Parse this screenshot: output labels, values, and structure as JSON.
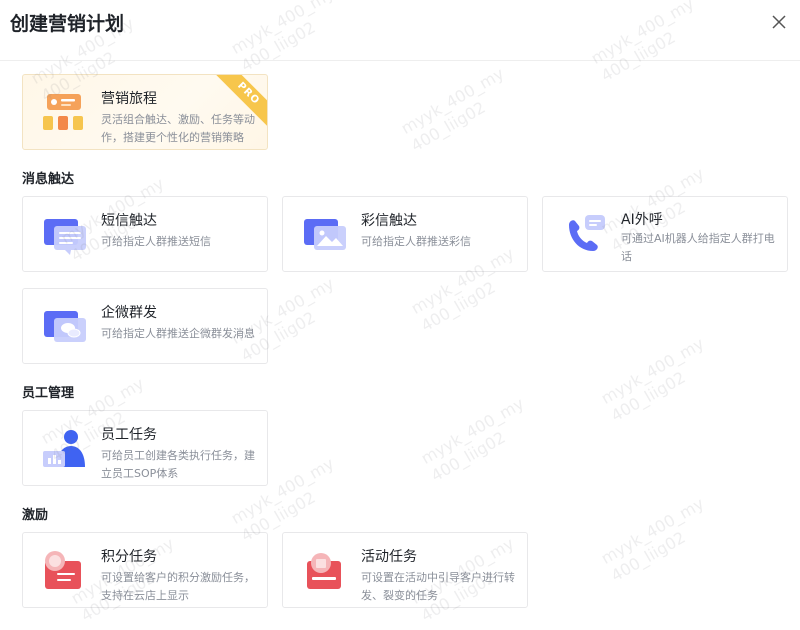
{
  "dialog": {
    "title": "创建营销计划",
    "close_icon": "close-icon"
  },
  "featured": {
    "title": "营销旅程",
    "desc": "灵活组合触达、激励、任务等动作，搭建更个性化的营销策略",
    "badge": "PRO",
    "icon": "journey-icon"
  },
  "sections": [
    {
      "title": "消息触达",
      "cards": [
        {
          "title": "短信触达",
          "desc": "可给指定人群推送短信",
          "icon": "sms-icon"
        },
        {
          "title": "彩信触达",
          "desc": "可给指定人群推送彩信",
          "icon": "mms-icon"
        },
        {
          "title": "AI外呼",
          "desc": "可通过AI机器人给指定人群打电话",
          "icon": "phone-icon"
        },
        {
          "title": "企微群发",
          "desc": "可给指定人群推送企微群发消息",
          "icon": "wecom-icon"
        }
      ]
    },
    {
      "title": "员工管理",
      "cards": [
        {
          "title": "员工任务",
          "desc": "可给员工创建各类执行任务，建立员工SOP体系",
          "icon": "staff-icon"
        }
      ]
    },
    {
      "title": "激励",
      "cards": [
        {
          "title": "积分任务",
          "desc": "可设置给客户的积分激励任务，支持在云店上显示",
          "icon": "points-icon"
        },
        {
          "title": "活动任务",
          "desc": "可设置在活动中引导客户进行转发、裂变的任务",
          "icon": "activity-icon"
        }
      ]
    }
  ],
  "watermark": {
    "line1": "myyk_400_my",
    "line2": "400_liig02"
  },
  "colors": {
    "accent_blue": "#5b6cf5",
    "accent_red": "#e8525a",
    "pro_gold": "#f7c64c"
  }
}
